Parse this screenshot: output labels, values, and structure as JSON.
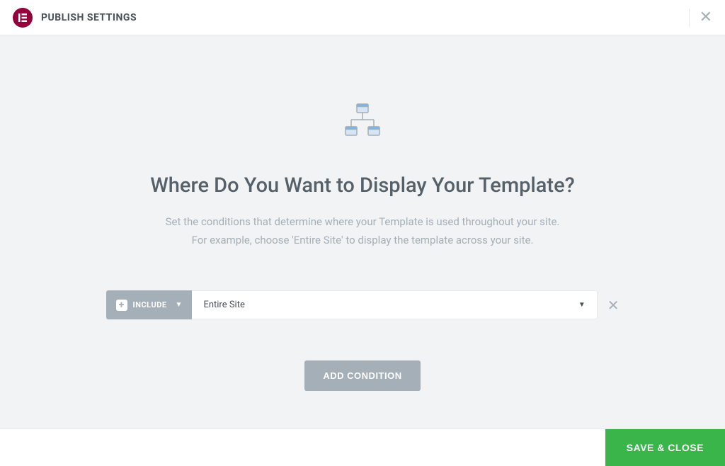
{
  "header": {
    "title": "PUBLISH SETTINGS"
  },
  "content": {
    "heading": "Where Do You Want to Display Your Template?",
    "description_line1": "Set the conditions that determine where your Template is used throughout your site.",
    "description_line2": "For example, choose 'Entire Site' to display the template across your site."
  },
  "condition": {
    "mode_label": "INCLUDE",
    "scope_value": "Entire Site"
  },
  "buttons": {
    "add_condition": "ADD CONDITION",
    "save_close": "SAVE & CLOSE"
  }
}
